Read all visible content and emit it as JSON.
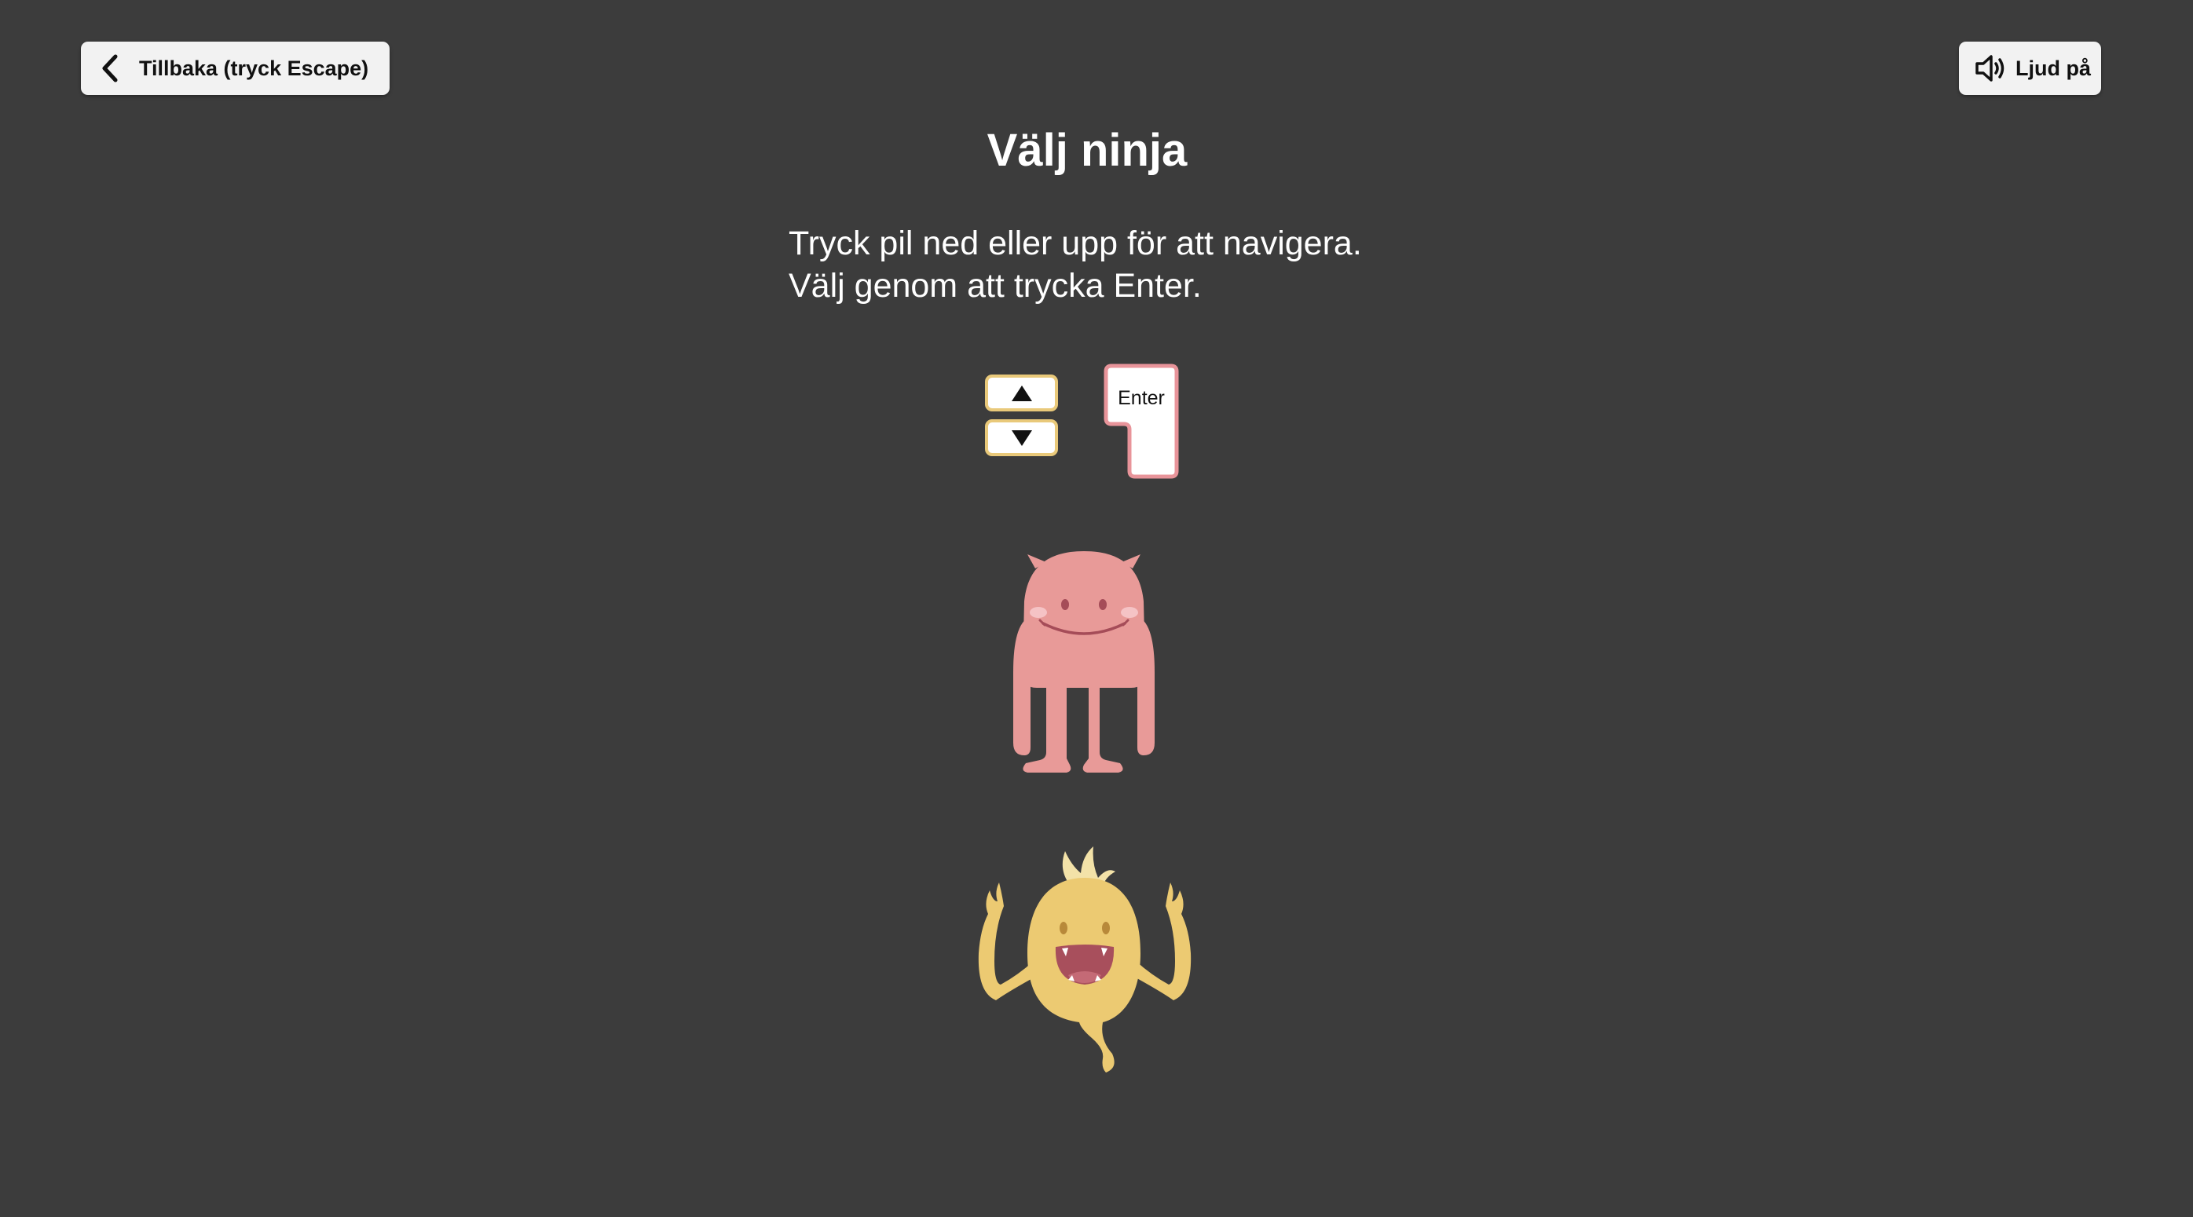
{
  "header": {
    "back_label": "Tillbaka (tryck Escape)",
    "back_icon": "chevron-left-icon",
    "sound_label": "Ljud på",
    "sound_icon": "speaker-icon"
  },
  "main": {
    "title": "Välj ninja",
    "instructions": [
      "Tryck pil ned eller upp för att navigera.",
      "Välj genom att trycka Enter."
    ]
  },
  "keys": {
    "enter_label": "Enter",
    "arrow_up_icon": "arrow-up-icon",
    "arrow_down_icon": "arrow-down-icon"
  },
  "ninjas": [
    {
      "name": "pink-monster",
      "color": "#e89a98"
    },
    {
      "name": "yellow-monster",
      "color": "#ecca72"
    }
  ],
  "colors": {
    "background": "#3c3c3c",
    "button_bg": "#f2f2f2",
    "arrow_key_border": "#e9c97a",
    "enter_key_border": "#e8949a",
    "pink_monster": "#e89a98",
    "yellow_monster": "#ecca72"
  }
}
